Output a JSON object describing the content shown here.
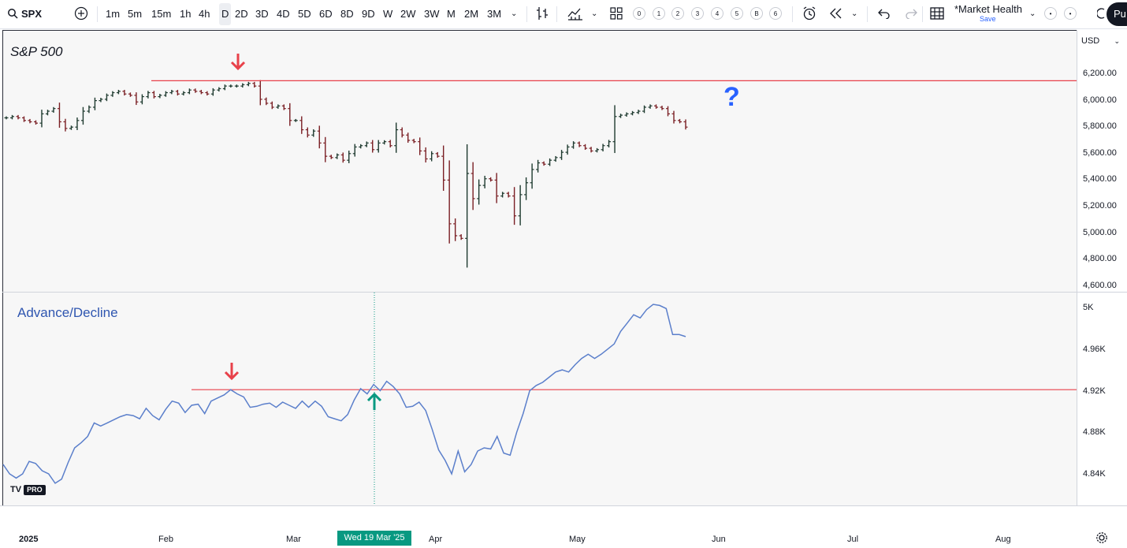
{
  "toolbar": {
    "symbol": "SPX",
    "intervals": [
      "1m",
      "5m",
      "15m",
      "1h",
      "4h",
      "D",
      "2D",
      "3D",
      "4D",
      "5D",
      "6D",
      "8D",
      "9D",
      "W",
      "2W",
      "3W",
      "M",
      "2M",
      "3M"
    ],
    "selected_interval": "D",
    "layouts": [
      "0",
      "1",
      "2",
      "3",
      "4",
      "5",
      "B",
      "6"
    ],
    "layout_name": "*Market Health",
    "layout_status": "Save",
    "publish_label": "Pu"
  },
  "price_scale": {
    "currency": "USD",
    "upper_labels": [
      "6,200.00",
      "6,000.00",
      "5,800.00",
      "5,600.00",
      "5,400.00",
      "5,200.00",
      "5,000.00",
      "4,800.00",
      "4,600.00"
    ],
    "lower_labels": [
      "5K",
      "4.96K",
      "4.92K",
      "4.88K",
      "4.84K"
    ]
  },
  "time_axis": {
    "labels": [
      "2025",
      "Feb",
      "Mar",
      "Apr",
      "May",
      "Jun",
      "Jul",
      "Aug"
    ],
    "crosshair_label": "Wed 19 Mar '25"
  },
  "panes": {
    "upper_title": "S&P 500",
    "lower_title": "Advance/Decline",
    "question_mark": "?",
    "logo_text": "TV",
    "logo_badge": "PRO"
  },
  "colors": {
    "up_bar": "#1e3a2f",
    "down_bar": "#7a1f24",
    "resistance_line": "#e8414a",
    "ad_line": "#5b7fcb",
    "arrow_down": "#e8414a",
    "arrow_up": "#089981",
    "crosshair": "#089981"
  },
  "chart_data": [
    {
      "type": "ohlc",
      "title": "S&P 500",
      "symbol": "SPX",
      "ylim": [
        4600,
        6300
      ],
      "x_range": [
        "2025-01-02",
        "2025-05-23"
      ],
      "resistance_level": 6150,
      "closes": [
        5870,
        5880,
        5870,
        5850,
        5840,
        5830,
        5900,
        5920,
        5940,
        5840,
        5790,
        5800,
        5850,
        5920,
        5950,
        6000,
        6010,
        6040,
        6060,
        6070,
        6050,
        6040,
        5990,
        6030,
        6060,
        6030,
        6040,
        6060,
        6070,
        6050,
        6060,
        6080,
        6070,
        6060,
        6050,
        6080,
        6090,
        6110,
        6110,
        6110,
        6120,
        6130,
        6110,
        6010,
        5980,
        5950,
        5960,
        5940,
        5850,
        5850,
        5780,
        5740,
        5770,
        5680,
        5580,
        5570,
        5590,
        5550,
        5600,
        5650,
        5660,
        5680,
        5630,
        5680,
        5690,
        5660,
        5780,
        5740,
        5700,
        5690,
        5620,
        5560,
        5600,
        5580,
        5400,
        5070,
        4980,
        4960,
        5450,
        5260,
        5360,
        5410,
        5400,
        5280,
        5300,
        5280,
        5130,
        5290,
        5380,
        5480,
        5530,
        5520,
        5550,
        5570,
        5610,
        5650,
        5680,
        5660,
        5640,
        5620,
        5630,
        5660,
        5690,
        5880,
        5890,
        5900,
        5910,
        5920,
        5950,
        5960,
        5950,
        5940,
        5900,
        5850,
        5840,
        5800
      ]
    },
    {
      "type": "line",
      "title": "Advance/Decline",
      "ylim": [
        4820,
        5020
      ],
      "x_range": [
        "2025-01-02",
        "2025-05-23"
      ],
      "resistance_level": 4921,
      "values": [
        4849,
        4840,
        4836,
        4840,
        4852,
        4850,
        4843,
        4840,
        4831,
        4835,
        4851,
        4865,
        4870,
        4876,
        4889,
        4886,
        4889,
        4892,
        4895,
        4897,
        4896,
        4893,
        4903,
        4896,
        4892,
        4902,
        4910,
        4908,
        4899,
        4906,
        4907,
        4898,
        4910,
        4913,
        4916,
        4921,
        4917,
        4914,
        4904,
        4905,
        4907,
        4908,
        4904,
        4909,
        4906,
        4903,
        4910,
        4904,
        4910,
        4905,
        4895,
        4893,
        4891,
        4897,
        4911,
        4922,
        4917,
        4926,
        4920,
        4929,
        4924,
        4917,
        4904,
        4905,
        4909,
        4901,
        4883,
        4863,
        4853,
        4840,
        4862,
        4842,
        4849,
        4862,
        4865,
        4864,
        4876,
        4860,
        4858,
        4880,
        4898,
        4920,
        4925,
        4928,
        4933,
        4938,
        4940,
        4938,
        4945,
        4951,
        4955,
        4951,
        4955,
        4960,
        4965,
        4977,
        4985,
        4993,
        4990,
        4998,
        5003,
        5002,
        4999,
        4974,
        4974,
        4972
      ]
    }
  ]
}
